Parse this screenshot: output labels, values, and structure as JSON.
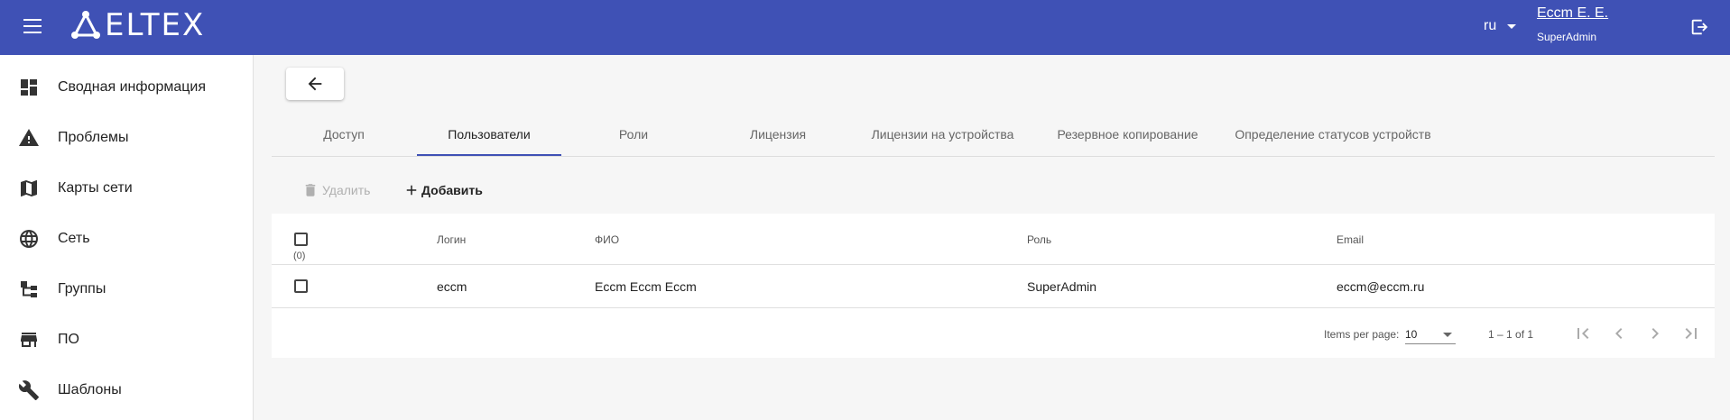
{
  "header": {
    "logo_text": "ELTEX",
    "language": "ru",
    "user_name": "Eccm E. E.",
    "user_role": "SuperAdmin"
  },
  "sidebar": {
    "items": [
      {
        "label": "Сводная информация",
        "icon": "dashboard-icon"
      },
      {
        "label": "Проблемы",
        "icon": "warning-icon"
      },
      {
        "label": "Карты сети",
        "icon": "map-icon"
      },
      {
        "label": "Сеть",
        "icon": "globe-icon"
      },
      {
        "label": "Группы",
        "icon": "groups-icon"
      },
      {
        "label": "ПО",
        "icon": "store-icon"
      },
      {
        "label": "Шаблоны",
        "icon": "wrench-icon"
      }
    ]
  },
  "tabs": [
    {
      "label": "Доступ"
    },
    {
      "label": "Пользователи",
      "active": true
    },
    {
      "label": "Роли"
    },
    {
      "label": "Лицензия"
    },
    {
      "label": "Лицензии на устройства"
    },
    {
      "label": "Резервное копирование"
    },
    {
      "label": "Определение статусов устройств"
    }
  ],
  "toolbar": {
    "delete_label": "Удалить",
    "add_label": "Добавить"
  },
  "table": {
    "selected_count": "(0)",
    "columns": [
      "Логин",
      "ФИО",
      "Роль",
      "Email"
    ],
    "rows": [
      {
        "login": "eccm",
        "fio": "Eccm Eccm Eccm",
        "role": "SuperAdmin",
        "email": "eccm@eccm.ru"
      }
    ]
  },
  "pagination": {
    "items_per_page_label": "Items per page:",
    "items_per_page": "10",
    "range": "1 – 1 of 1"
  },
  "colors": {
    "header_bg": "#3f51b5",
    "tab_ink": "#3f51b5"
  }
}
